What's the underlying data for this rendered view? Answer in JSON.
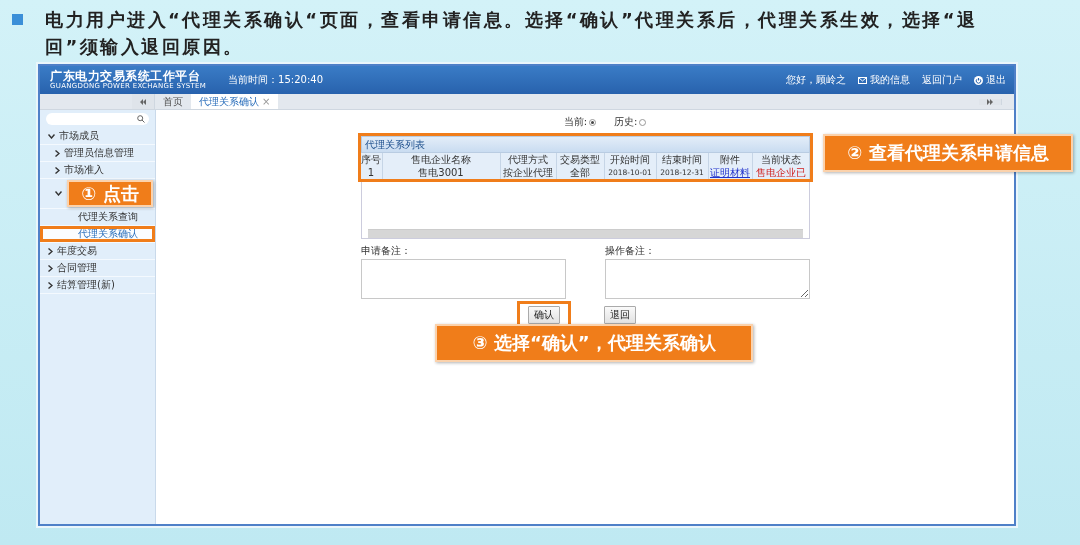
{
  "heading": "电力用户进入“代理关系确认“页面，查看申请信息。选择“确认”代理关系后，代理关系生效，选择“退回”须输入退回原因。",
  "app": {
    "title": "广东电力交易系统工作平台",
    "subtitle": "GUANGDONG POWER EXCHANGE SYSTEM",
    "clock": "当前时间：15:20:40",
    "greeting": "您好，顾岭之",
    "links": [
      {
        "label": "我的信息",
        "kind": "mail"
      },
      {
        "label": "返回门户",
        "kind": "plain"
      },
      {
        "label": "退出",
        "kind": "power"
      }
    ]
  },
  "tabs": [
    {
      "label": "首页",
      "selected": false
    },
    {
      "label": "代理关系确认",
      "selected": true,
      "close": "×"
    }
  ],
  "sidebar": {
    "items": [
      {
        "label": "市场成员",
        "expanded": true,
        "selected": false,
        "highlighted": false,
        "children": [
          {
            "label": "管理员信息管理",
            "expanded": false,
            "selected": false,
            "highlighted": false
          },
          {
            "label": "市场准入",
            "expanded": false,
            "selected": false,
            "highlighted": false
          },
          {
            "expanded": true,
            "selected": false,
            "highlighted": false,
            "children": [
              {
                "label": "代理关系查询",
                "selected": false,
                "highlighted": false
              },
              {
                "label": "代理关系确认",
                "selected": true,
                "highlighted": true
              }
            ]
          }
        ]
      },
      {
        "label": "年度交易",
        "expanded": false,
        "selected": false,
        "highlighted": false
      },
      {
        "label": "合同管理",
        "expanded": false,
        "selected": false,
        "highlighted": false
      },
      {
        "label": "结算管理(新)",
        "expanded": false,
        "selected": false,
        "highlighted": false
      }
    ]
  },
  "filter": {
    "options": [
      {
        "label": "当前:",
        "selected": true
      },
      {
        "label": "历史:",
        "selected": false
      }
    ]
  },
  "table": {
    "title": "代理关系列表",
    "highlighted": true,
    "columns": [
      "序号",
      "售电企业名称",
      "代理方式",
      "交易类型",
      "开始时间",
      "结束时间",
      "附件",
      "当前状态"
    ],
    "rows": [
      [
        {
          "text": "1",
          "kind": "text"
        },
        {
          "text": "售电3001",
          "kind": "text"
        },
        {
          "text": "按企业代理",
          "kind": "text"
        },
        {
          "text": "全部",
          "kind": "text"
        },
        {
          "text": "2018-10-01",
          "kind": "date"
        },
        {
          "text": "2018-12-31",
          "kind": "date"
        },
        {
          "text": "证明材料",
          "kind": "link"
        },
        {
          "text": "售电企业已",
          "kind": "status"
        }
      ]
    ]
  },
  "remarks": [
    {
      "label": "申请备注："
    },
    {
      "label": "操作备注："
    }
  ],
  "buttons": [
    {
      "label": "确认",
      "highlighted": true
    },
    {
      "label": "退回",
      "highlighted": false
    }
  ],
  "callouts": [
    "① 点击",
    "② 查看代理关系申请信息",
    "③ 选择“确认”，代理关系确认"
  ]
}
